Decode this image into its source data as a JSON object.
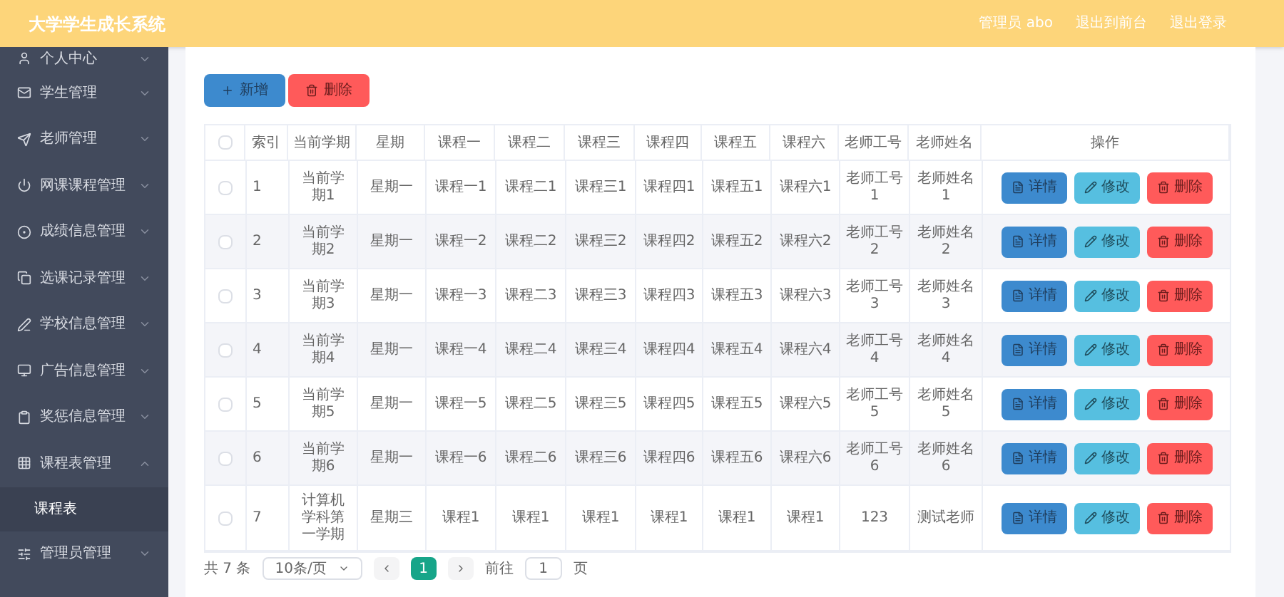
{
  "header": {
    "title": "大学学生成长系统",
    "links": [
      "管理员 abo",
      "退出到前台",
      "退出登录"
    ]
  },
  "sidebar": {
    "items": [
      {
        "label": "个人中心",
        "expanded": false
      },
      {
        "label": "学生管理",
        "expanded": false
      },
      {
        "label": "老师管理",
        "expanded": false
      },
      {
        "label": "网课课程管理",
        "expanded": false
      },
      {
        "label": "成绩信息管理",
        "expanded": false
      },
      {
        "label": "选课记录管理",
        "expanded": false
      },
      {
        "label": "学校信息管理",
        "expanded": false
      },
      {
        "label": "广告信息管理",
        "expanded": false
      },
      {
        "label": "奖惩信息管理",
        "expanded": false
      },
      {
        "label": "课程表管理",
        "expanded": true,
        "children": [
          {
            "label": "课程表",
            "selected": true
          }
        ]
      },
      {
        "label": "管理员管理",
        "expanded": false
      }
    ]
  },
  "toolbar": {
    "add": "新增",
    "delete": "删除"
  },
  "table": {
    "columns": [
      "索引",
      "当前学期",
      "星期",
      "课程一",
      "课程二",
      "课程三",
      "课程四",
      "课程五",
      "课程六",
      "老师工号",
      "老师姓名",
      "操作"
    ],
    "header_checked": false,
    "rows": [
      {
        "checked": false,
        "cells": [
          "1",
          "当前学期1",
          "星期一",
          "课程一1",
          "课程二1",
          "课程三1",
          "课程四1",
          "课程五1",
          "课程六1",
          "老师工号1",
          "老师姓名1"
        ],
        "actions": [
          "详情",
          "修改",
          "删除"
        ]
      },
      {
        "checked": false,
        "cells": [
          "2",
          "当前学期2",
          "星期一",
          "课程一2",
          "课程二2",
          "课程三2",
          "课程四2",
          "课程五2",
          "课程六2",
          "老师工号2",
          "老师姓名2"
        ],
        "actions": [
          "详情",
          "修改",
          "删除"
        ]
      },
      {
        "checked": false,
        "cells": [
          "3",
          "当前学期3",
          "星期一",
          "课程一3",
          "课程二3",
          "课程三3",
          "课程四3",
          "课程五3",
          "课程六3",
          "老师工号3",
          "老师姓名3"
        ],
        "actions": [
          "详情",
          "修改",
          "删除"
        ]
      },
      {
        "checked": false,
        "cells": [
          "4",
          "当前学期4",
          "星期一",
          "课程一4",
          "课程二4",
          "课程三4",
          "课程四4",
          "课程五4",
          "课程六4",
          "老师工号4",
          "老师姓名4"
        ],
        "actions": [
          "详情",
          "修改",
          "删除"
        ]
      },
      {
        "checked": false,
        "cells": [
          "5",
          "当前学期5",
          "星期一",
          "课程一5",
          "课程二5",
          "课程三5",
          "课程四5",
          "课程五5",
          "课程六5",
          "老师工号5",
          "老师姓名5"
        ],
        "actions": [
          "详情",
          "修改",
          "删除"
        ]
      },
      {
        "checked": false,
        "cells": [
          "6",
          "当前学期6",
          "星期一",
          "课程一6",
          "课程二6",
          "课程三6",
          "课程四6",
          "课程五6",
          "课程六6",
          "老师工号6",
          "老师姓名6"
        ],
        "actions": [
          "详情",
          "修改",
          "删除"
        ]
      },
      {
        "checked": false,
        "cells": [
          "7",
          "计算机学科第一学期",
          "星期三",
          "课程1",
          "课程1",
          "课程1",
          "课程1",
          "课程1",
          "课程1",
          "123",
          "测试老师"
        ],
        "actions": [
          "详情",
          "修改",
          "删除"
        ]
      }
    ]
  },
  "pagination": {
    "total": "共 7 条",
    "page_size": "10条/页",
    "pages": [
      {
        "label": "1",
        "selected": true
      }
    ],
    "goto_label": "前往",
    "goto_value": "1",
    "goto_suffix": "页"
  }
}
